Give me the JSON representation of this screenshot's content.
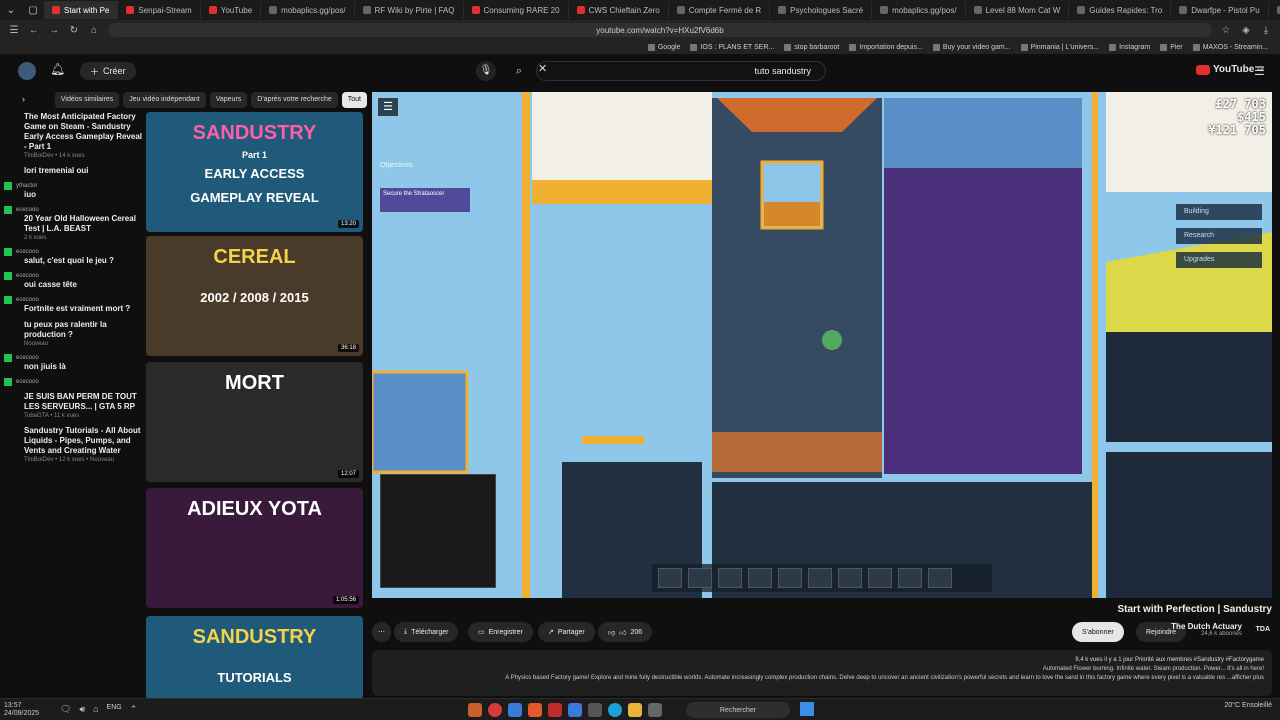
{
  "browser": {
    "tabs": [
      {
        "label": "Start with Pe",
        "active": true,
        "red": true
      },
      {
        "label": "Senpai-Stream",
        "red": true
      },
      {
        "label": "YouTube",
        "red": true
      },
      {
        "label": "mobaplics.gg/pos/"
      },
      {
        "label": "RF Wiki by Pirte | FAQ"
      },
      {
        "label": "Consuming RARE 20",
        "red": true
      },
      {
        "label": "CWS Chieftain Zero",
        "red": true
      },
      {
        "label": "Compte Fermé de R"
      },
      {
        "label": "Psychologues Sacré"
      },
      {
        "label": "mobaplics.gg/pos/"
      },
      {
        "label": "Level 88 Mom Cat W"
      },
      {
        "label": "Guides Rapides: Tro"
      },
      {
        "label": "Dwarfpe - Pistol Pu"
      },
      {
        "label": "Level 60 Occultist"
      }
    ],
    "url": "youtube.com/watch?v=HXu2fV6d6b",
    "bookmarks": [
      "Google",
      "IOS : PLANS ET SER...",
      "stop barbaroot",
      "Importation depuis...",
      "Buy your video gam...",
      "Pinmania | L'univers...",
      "Instagram",
      "Pier",
      "MAXOS - Streamin..."
    ]
  },
  "youtube": {
    "search_value": "tuto sandustry",
    "create_label": "Créer",
    "logo_text": "YouTube",
    "logo_sup": "FR",
    "chips": [
      "Tout",
      "D'après votre recherche",
      "Vapeurs",
      "Jeu vidéo indépendant",
      "Vidéos similaires"
    ],
    "chat": [
      {
        "user": "",
        "text": "The Most Anticipated Factory Game on Steam - Sandustry Early Access Gameplay Reveal - Part 1",
        "meta": "TimBotDev • 14 k vues"
      },
      {
        "user": "",
        "text": "lori tremenial oui",
        "meta": ""
      },
      {
        "user": "ythactor",
        "text": "iuo",
        "meta": ""
      },
      {
        "user": "ececooo",
        "text": "20 Year Old Halloween Cereal Test | L.A. BEAST",
        "meta": "2 k vues"
      },
      {
        "user": "ececooo",
        "text": "salut, c'est quoi le jeu ?",
        "meta": ""
      },
      {
        "user": "ececooo",
        "text": "oui casse tête",
        "meta": ""
      },
      {
        "user": "ececooo",
        "text": "Fortnite est vraiment mort ?",
        "meta": ""
      },
      {
        "user": "",
        "text": "tu peux pas ralentir la production ?",
        "meta": "Nouveau"
      },
      {
        "user": "ececooo",
        "text": "non jiuis là",
        "meta": ""
      },
      {
        "user": "ececooo",
        "text": "",
        "meta": ""
      },
      {
        "user": "",
        "text": "JE SUIS BAN PERM DE TOUT LES SERVEURS... | GTA 5 RP",
        "meta": "TobaGTA • 11 k vues"
      },
      {
        "user": "",
        "text": "Sandustry Tutorials - All About Liquids - Pipes, Pumps, and Vents and Creating Water",
        "meta": "TimBotDev • 12 k vues • Nouveau"
      }
    ],
    "thumbs": [
      {
        "title": "SANDUSTRY",
        "sub": "EARLY ACCESS",
        "sub2": "GAMEPLAY REVEAL",
        "part": "Part 1",
        "dur": "13:20",
        "bg": "#1f5a7a",
        "fg": "#ff5fa8"
      },
      {
        "title": "CEREAL",
        "sub": "2002 / 2008 / 2015",
        "sub2": "",
        "part": "",
        "dur": "36:18",
        "bg": "#4a3a2a",
        "fg": "#f5d24a"
      },
      {
        "title": "MORT",
        "sub": "",
        "sub2": "",
        "part": "",
        "dur": "12:07",
        "bg": "#2a2a2a",
        "fg": "#ffffff"
      },
      {
        "title": "ADIEUX YOTA",
        "sub": "",
        "sub2": "",
        "part": "",
        "dur": "1:05:56",
        "bg": "#3a1a3a",
        "fg": "#ffffff"
      },
      {
        "title": "SANDUSTRY",
        "sub": "TUTORIALS",
        "sub2": "",
        "part": "",
        "dur": "",
        "bg": "#1f5a7a",
        "fg": "#f5d24a"
      }
    ],
    "video": {
      "title": "Start with Perfection | Sandustry",
      "channel": "The Dutch Actuary",
      "channel_avatar": "TDA",
      "subs": "24,6 k abonnés",
      "join": "Rejoindre",
      "subscribe": "S'abonner",
      "likes": "206",
      "share": "Partager",
      "save": "Enregistrer",
      "download": "Télécharger",
      "desc_meta": "9,4 k vues  il y a 1 jour  Priorité aux membres  #Sandustry #Factorygame",
      "desc_line1": "Automated Flower burning. Infinite water. Steam production. Power... It's all in here!",
      "desc_line2": "A Physics based Factory game! Explore and mine fully destructible worlds. Automate increasingly complex production chains. Delve deep to uncover an ancient civilization's powerful secrets and learn to love the sand in this factory game where every pixel is a valuable res ...afficher plus"
    },
    "game_hud": {
      "stats": [
        "£27 703",
        "$415",
        "¥121 705"
      ],
      "side_buttons": [
        "Building",
        "Research",
        "Upgrades"
      ],
      "objectives_label": "Objectives",
      "objective_text": "Secure the Strataoscer",
      "aura_label": "Aura"
    }
  },
  "taskbar": {
    "search": "Rechercher",
    "time": "13:57",
    "date": "24/09/2025",
    "lang": "ENG",
    "weather": "20°C  Ensoleillé"
  }
}
